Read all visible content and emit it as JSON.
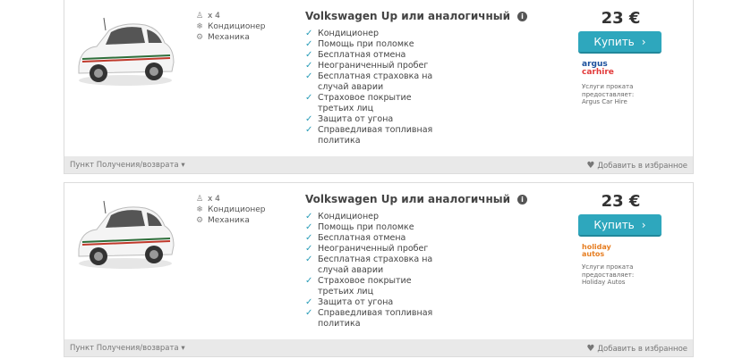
{
  "listings": [
    {
      "specs": {
        "passengers": "x 4",
        "ac": "Кондиционер",
        "transmission": "Механика"
      },
      "title": "Volkswagen Up или аналогичный",
      "features": [
        "Кондиционер",
        "Помощь при поломке",
        "Бесплатная отмена",
        "Неограниченный пробег",
        "Бесплатная страховка на случай аварии",
        "Страховое покрытие третьих лиц",
        "Защита от угона",
        "Справедливая топливная политика"
      ],
      "price": "23 €",
      "buy_label": "Купить",
      "logo_text_1": "argus",
      "logo_text_2": "carhire",
      "provider_line1": "Услуги проката",
      "provider_line2": "предоставляет:",
      "provider_name": "Argus Car Hire",
      "pickup_label": "Пункт Получения/возврата",
      "fav_label": "Добавить в избранное"
    },
    {
      "specs": {
        "passengers": "x 4",
        "ac": "Кондиционер",
        "transmission": "Механика"
      },
      "title": "Volkswagen Up или аналогичный",
      "features": [
        "Кондиционер",
        "Помощь при поломке",
        "Бесплатная отмена",
        "Неограниченный пробег",
        "Бесплатная страховка на случай аварии",
        "Страховое покрытие третьих лиц",
        "Защита от угона",
        "Справедливая топливная политика"
      ],
      "price": "23 €",
      "buy_label": "Купить",
      "logo_text_1": "holiday",
      "logo_text_2": "autos",
      "provider_line1": "Услуги проката",
      "provider_line2": "предоставляет:",
      "provider_name": "Holiday Autos",
      "pickup_label": "Пункт Получения/возврата",
      "fav_label": "Добавить в избранное"
    }
  ],
  "colors": {
    "accent": "#2ea7bd",
    "check": "#2a9db8",
    "footer_bg": "#e9e9e9"
  }
}
